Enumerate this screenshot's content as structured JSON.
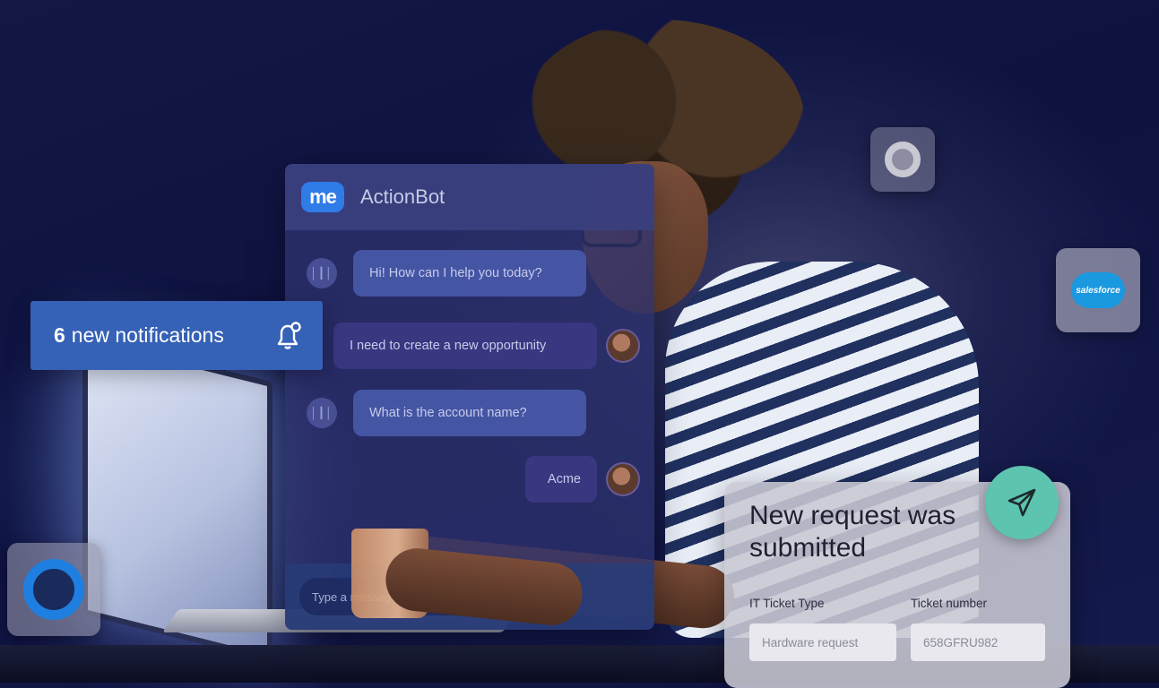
{
  "chatbot": {
    "logo_text": "me",
    "title": "ActionBot",
    "messages": [
      {
        "sender": "bot",
        "text": "Hi! How can I help you today?"
      },
      {
        "sender": "user",
        "text": "I need to create a new opportunity"
      },
      {
        "sender": "bot",
        "text": "What is the account name?"
      },
      {
        "sender": "user",
        "text": "Acme"
      }
    ],
    "bot_icon_glyph": "│┃│",
    "input_placeholder": "Type a message"
  },
  "notification": {
    "count": "6",
    "text": "new notifications",
    "icon": "bell-icon"
  },
  "request_card": {
    "title": "New request was submitted",
    "icon": "send-icon",
    "accent_color": "#5dc4b0",
    "fields": [
      {
        "label": "IT Ticket Type",
        "value": "Hardware request"
      },
      {
        "label": "Ticket number",
        "value": "658GFRU982"
      }
    ]
  },
  "app_tiles": {
    "salesforce_label": "salesforce"
  },
  "colors": {
    "background": "#121745",
    "notification_bg": "#3561b6",
    "me_logo": "#2f7be8",
    "salesforce": "#1a98e0"
  }
}
